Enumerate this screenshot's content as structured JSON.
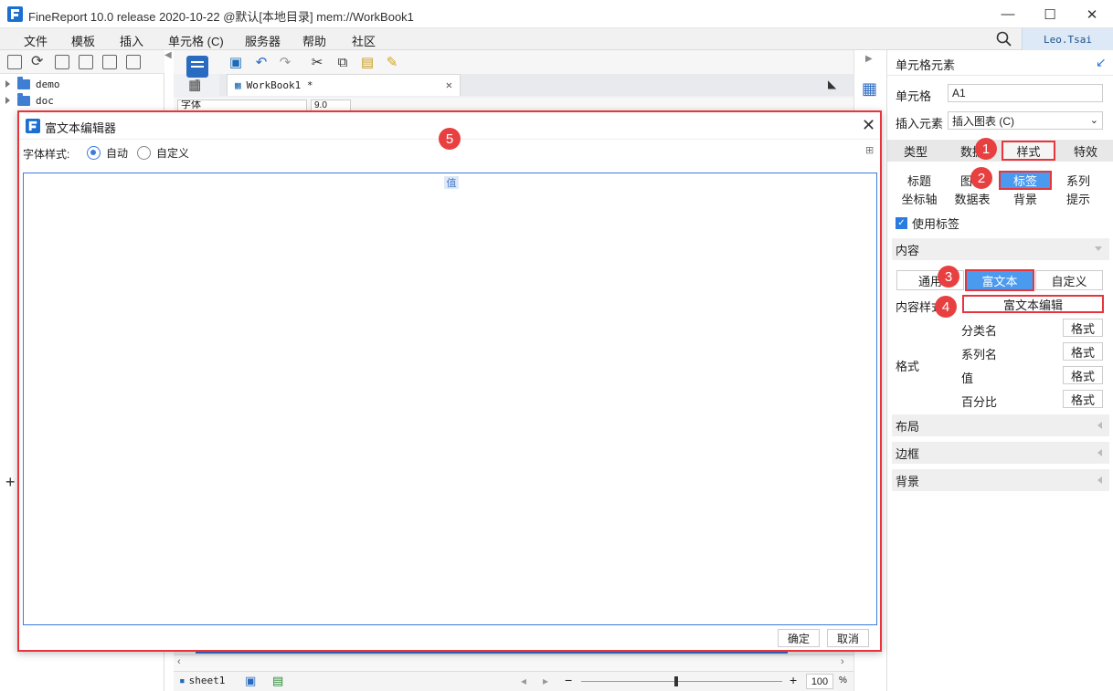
{
  "window": {
    "title": "FineReport 10.0 release 2020-10-22 @默认[本地目录]    mem://WorkBook1",
    "min_glyph": "—",
    "max_glyph": "☐",
    "close_glyph": "✕"
  },
  "menubar": {
    "items": [
      "文件",
      "模板",
      "插入",
      "单元格 (C)",
      "服务器",
      "帮助",
      "社区"
    ],
    "user": "Leo.Tsai"
  },
  "tree": {
    "items": [
      {
        "label": "demo"
      },
      {
        "label": "doc"
      }
    ]
  },
  "editor": {
    "tab_label": "WorkBook1 *",
    "font_placeholder": "字体",
    "font_size": "9.0",
    "sheet_name": "sheet1",
    "zoom": "100",
    "zoom_unit": "%"
  },
  "right_panel": {
    "header": "单元格元素",
    "cell_label": "单元格",
    "cell_value": "A1",
    "insert_label": "插入元素",
    "insert_value": "插入图表 (C)",
    "main_tabs": [
      "类型",
      "数据",
      "样式",
      "特效"
    ],
    "sub_tabs_row1": [
      "标题",
      "图例",
      "标签",
      "系列"
    ],
    "sub_tabs_row2": [
      "坐标轴",
      "数据表",
      "背景",
      "提示"
    ],
    "use_label_checkbox": "使用标签",
    "content_section": "内容",
    "content_modes": [
      "通用",
      "富文本",
      "自定义"
    ],
    "content_style_label": "内容样式",
    "rich_text_edit_button": "富文本编辑",
    "format_label": "格式",
    "format_rows": [
      {
        "label": "分类名",
        "button": "格式"
      },
      {
        "label": "系列名",
        "button": "格式"
      },
      {
        "label": "值",
        "button": "格式"
      },
      {
        "label": "百分比",
        "button": "格式"
      }
    ],
    "collapsed_sections": [
      "布局",
      "边框",
      "背景"
    ]
  },
  "steps": [
    "1",
    "2",
    "3",
    "4",
    "5"
  ],
  "dialog": {
    "title": "富文本编辑器",
    "font_style_label": "字体样式:",
    "radio_auto": "自动",
    "radio_custom": "自定义",
    "value_token": "值",
    "ok_button": "确定",
    "cancel_button": "取消"
  },
  "colors": {
    "accent": "#3b7be0",
    "highlight_red": "#e8343b",
    "selected_tab": "#4a9af0"
  }
}
